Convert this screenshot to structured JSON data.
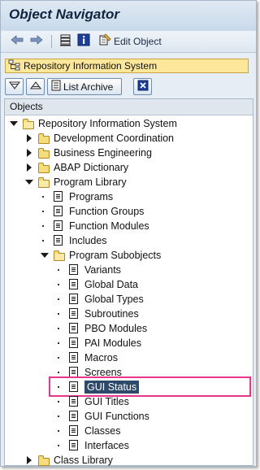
{
  "window": {
    "title": "Object Navigator"
  },
  "toolbar": {
    "back_icon": "arrow-left-icon",
    "forward_icon": "arrow-right-icon",
    "edit_object_label": "Edit Object"
  },
  "ris_bar": {
    "label": "Repository Information System"
  },
  "buttons": {
    "list_archive_label": "List Archive"
  },
  "tree": {
    "header": "Objects",
    "items": [
      {
        "label": "Repository Information System",
        "icon": "folder-open"
      },
      {
        "label": "Development Coordination",
        "icon": "folder"
      },
      {
        "label": "Business Engineering",
        "icon": "folder"
      },
      {
        "label": "ABAP Dictionary",
        "icon": "folder"
      },
      {
        "label": "Program Library",
        "icon": "folder-open"
      },
      {
        "label": "Programs",
        "icon": "document"
      },
      {
        "label": "Function Groups",
        "icon": "document"
      },
      {
        "label": "Function Modules",
        "icon": "document"
      },
      {
        "label": "Includes",
        "icon": "document"
      },
      {
        "label": "Program Subobjects",
        "icon": "folder-open"
      },
      {
        "label": "Variants",
        "icon": "document"
      },
      {
        "label": "Global Data",
        "icon": "document"
      },
      {
        "label": "Global Types",
        "icon": "document"
      },
      {
        "label": "Subroutines",
        "icon": "document"
      },
      {
        "label": "PBO Modules",
        "icon": "document"
      },
      {
        "label": "PAI Modules",
        "icon": "document"
      },
      {
        "label": "Macros",
        "icon": "document"
      },
      {
        "label": "Screens",
        "icon": "document"
      },
      {
        "label": "GUI Status",
        "icon": "document",
        "selected": true
      },
      {
        "label": "GUI Titles",
        "icon": "document"
      },
      {
        "label": "GUI Functions",
        "icon": "document"
      },
      {
        "label": "Classes",
        "icon": "document"
      },
      {
        "label": "Interfaces",
        "icon": "document"
      },
      {
        "label": "Class Library",
        "icon": "folder"
      }
    ]
  },
  "colors": {
    "accent_highlight": "#e8368f",
    "selection": "#2e4a6b",
    "ris_bar": "#fde79a"
  }
}
